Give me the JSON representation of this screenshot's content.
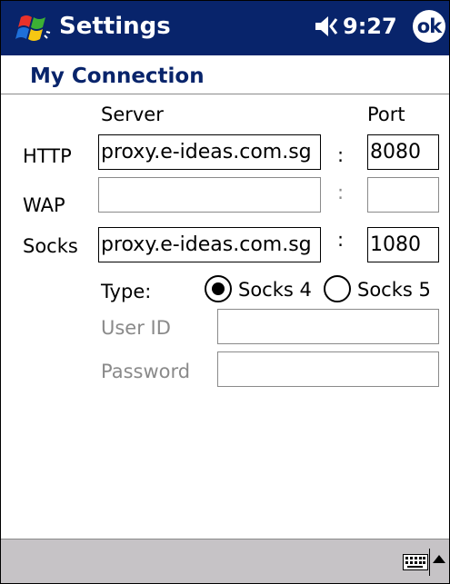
{
  "titlebar": {
    "title": "Settings",
    "time": "9:27",
    "ok_label": "ok",
    "start_icon": "windows-flag-icon",
    "volume_icon": "speaker-icon",
    "colors": {
      "bar": "#08246b",
      "text": "#ffffff"
    }
  },
  "page": {
    "heading": "My Connection",
    "heading_color": "#08246b"
  },
  "columns": {
    "server": "Server",
    "port": "Port"
  },
  "rows": {
    "http": {
      "label": "HTTP",
      "server": "proxy.e-ideas.com.sg",
      "port": "8080"
    },
    "wap": {
      "label": "WAP",
      "server": "",
      "port": ""
    },
    "socks": {
      "label": "Socks",
      "server": "proxy.e-ideas.com.sg",
      "port": "1080"
    }
  },
  "separator": ":",
  "type": {
    "label": "Type:",
    "options": [
      "Socks 4",
      "Socks 5"
    ],
    "selected": "Socks 4"
  },
  "auth": {
    "user_id_label": "User ID",
    "user_id_value": "",
    "password_label": "Password",
    "password_value": ""
  },
  "bottombar": {
    "keyboard_icon": "keyboard-icon",
    "menu_icon": "up-arrow-icon",
    "color": "#c6c3c6"
  }
}
